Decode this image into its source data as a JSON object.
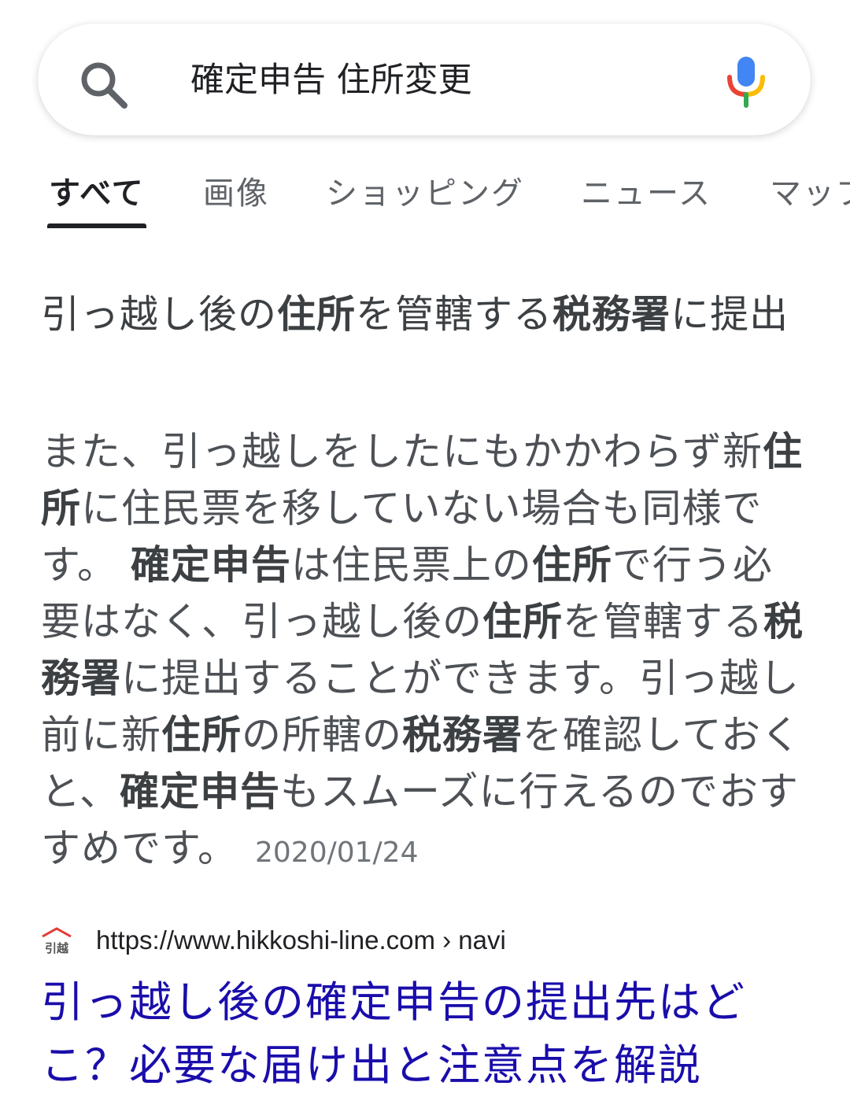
{
  "search": {
    "query": "確定申告 住所変更"
  },
  "tabs": [
    {
      "label": "すべて",
      "active": true
    },
    {
      "label": "画像"
    },
    {
      "label": "ショッピング"
    },
    {
      "label": "ニュース"
    },
    {
      "label": "マップ"
    }
  ],
  "featured": {
    "title_parts": [
      "引っ越し後の",
      "住所",
      "を管轄する",
      "税務署",
      "に提出"
    ],
    "snippet_parts": [
      "また、引っ越しをしたにもかかわらず新",
      "住所",
      "に住民票を移していない場合も同様です。 ",
      "確定申告",
      "は住民票上の",
      "住所",
      "で行う必要はなく、引っ越し後の",
      "住所",
      "を管轄する",
      "税務署",
      "に提出することができます。引っ越し前に新",
      "住所",
      "の所轄の",
      "税務署",
      "を確認しておくと、",
      "確定申告",
      "もスムーズに行えるのでおすすめです。"
    ],
    "date": "2020/01/24"
  },
  "result": {
    "favicon_text": "引越",
    "url": "https://www.hikkoshi-line.com › navi",
    "title": "引っ越し後の確定申告の提出先はどこ？必要な届け出と注意点を解説"
  },
  "colors": {
    "link": "#1a0dab",
    "text": "#202124",
    "muted": "#5f6368",
    "mic_blue": "#4285f4",
    "mic_red": "#ea4335",
    "mic_yellow": "#fbbc05",
    "mic_green": "#34a853"
  }
}
